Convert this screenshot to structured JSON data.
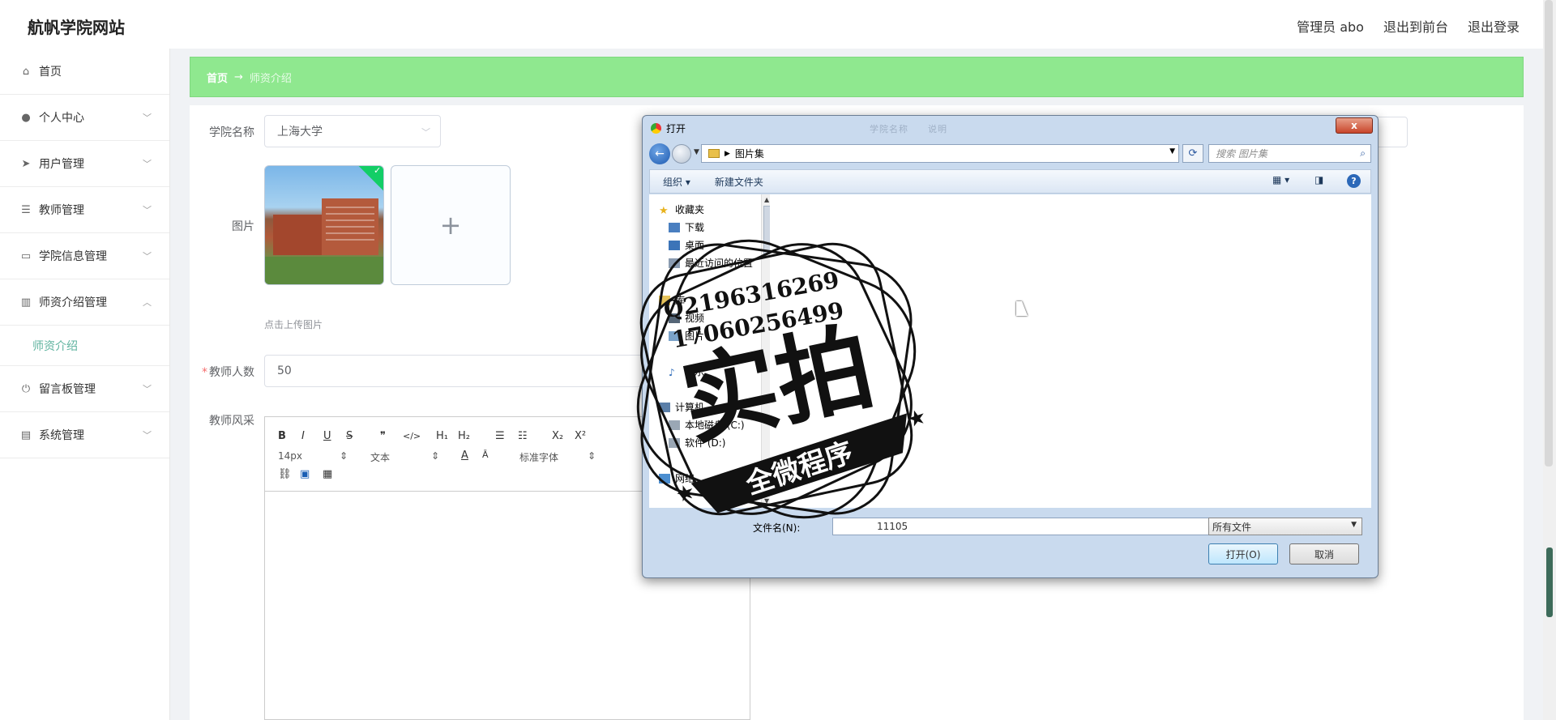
{
  "header": {
    "site_title": "航帆学院网站",
    "admin_label": "管理员 abo",
    "to_front": "退出到前台",
    "logout": "退出登录"
  },
  "sidebar": {
    "items": [
      {
        "label": "首页",
        "icon": "home-icon"
      },
      {
        "label": "个人中心",
        "icon": "user-icon"
      },
      {
        "label": "用户管理",
        "icon": "send-icon"
      },
      {
        "label": "教师管理",
        "icon": "sliders-icon"
      },
      {
        "label": "学院信息管理",
        "icon": "chat-icon"
      },
      {
        "label": "师资介绍管理",
        "icon": "library-icon"
      },
      {
        "label": "留言板管理",
        "icon": "power-icon"
      },
      {
        "label": "系统管理",
        "icon": "card-icon"
      }
    ],
    "sub_item": "师资介绍"
  },
  "breadcrumb": {
    "home": "首页",
    "arrow": "→",
    "current": "师资介绍"
  },
  "form": {
    "college_label": "学院名称",
    "college_value": "上海大学",
    "image_label": "图片",
    "upload_tip": "点击上传图片",
    "plus": "+",
    "teacher_count_label": "教师人数",
    "teacher_count_required": "*",
    "teacher_count_value": "50",
    "style_label": "教师风采"
  },
  "editor": {
    "bold": "B",
    "italic": "I",
    "underline": "U",
    "strike": "S",
    "quote": "❞",
    "code": "</>",
    "h1": "H₁",
    "h2": "H₂",
    "ol": "☰",
    "ul": "☷",
    "sub": "X₂",
    "sup": "X²",
    "size": "14px",
    "text": "文本",
    "font": "标准字体"
  },
  "dialog": {
    "title": "打开",
    "close": "x",
    "blur_text": "学院名称　　说明",
    "path": "图片集",
    "search_placeholder": "搜索 图片集",
    "organize": "组织 ▾",
    "new_folder": "新建文件夹",
    "tree": {
      "favorites": "收藏夹",
      "downloads": "下载",
      "desktop": "桌面",
      "recent": "最近访问的位置",
      "library": "库",
      "video": "视频",
      "pictures": "图片",
      "music": "音乐",
      "computer": "计算机",
      "local_disk": "本地磁盘 (C:)",
      "software": "软件 (D:)",
      "network": "网络"
    },
    "filename_label": "文件名(N):",
    "filename_value": "11105",
    "filetype": "所有文件",
    "open_button": "打开(O)",
    "cancel_button": "取消"
  },
  "watermark": {
    "qq": "Q2196316269",
    "phone": "17060256499",
    "big_text": "实拍",
    "banner": "全微程序"
  }
}
